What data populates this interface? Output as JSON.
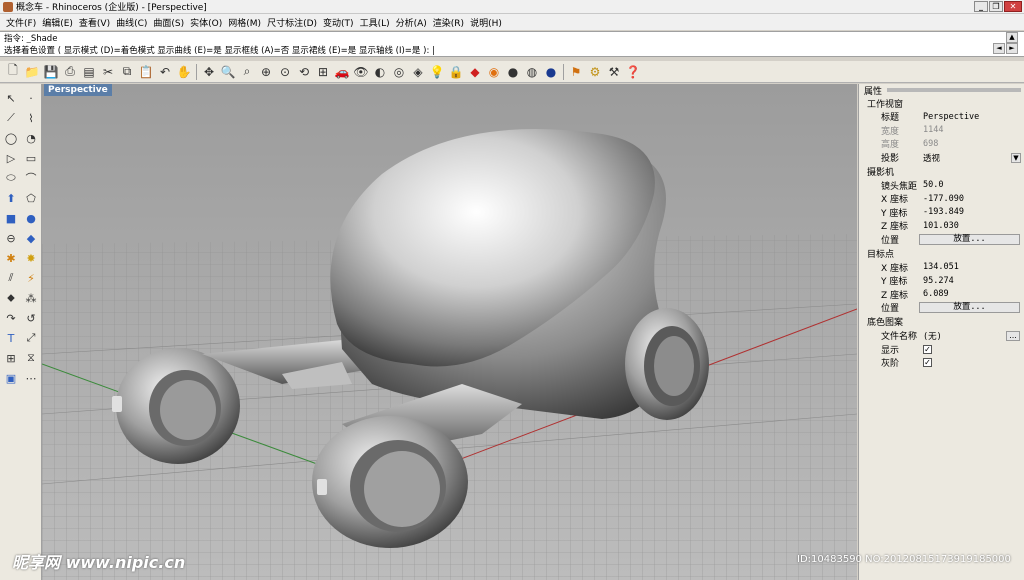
{
  "window": {
    "title": "概念车 - Rhinoceros (企业版) - [Perspective]"
  },
  "menu": [
    "文件(F)",
    "编辑(E)",
    "查看(V)",
    "曲线(C)",
    "曲面(S)",
    "实体(O)",
    "网格(M)",
    "尺寸标注(D)",
    "变动(T)",
    "工具(L)",
    "分析(A)",
    "渲染(R)",
    "说明(H)"
  ],
  "command": {
    "line1": "指令: _Shade",
    "line2": "选择着色设置 ( 显示模式 (D)=着色模式  显示曲线 (E)=是  显示框线 (A)=否  显示裙线 (E)=是  显示轴线 (I)=是 ): |"
  },
  "viewport": {
    "tab_label": "Perspective"
  },
  "properties": {
    "header": "属性",
    "section_viewport": "工作视窗",
    "title_label": "标题",
    "title_value": "Perspective",
    "width_label": "宽度",
    "width_value": "1144",
    "height_label": "高度",
    "height_value": "698",
    "projection_label": "投影",
    "projection_value": "透视",
    "section_camera": "摄影机",
    "lens_label": "镜头焦距",
    "lens_value": "50.0",
    "cam_x_label": "X 座标",
    "cam_x_value": "-177.090",
    "cam_y_label": "Y 座标",
    "cam_y_value": "-193.849",
    "cam_z_label": "Z 座标",
    "cam_z_value": "101.030",
    "cam_pos_label": "位置",
    "cam_pos_button": "放置...",
    "section_target": "目标点",
    "tgt_x_label": "X 座标",
    "tgt_x_value": "134.051",
    "tgt_y_label": "Y 座标",
    "tgt_y_value": "95.274",
    "tgt_z_label": "Z 座标",
    "tgt_z_value": "6.089",
    "tgt_pos_label": "位置",
    "tgt_pos_button": "放置...",
    "section_background": "底色图案",
    "file_label": "文件名称",
    "file_value": "(无)",
    "show_label": "显示",
    "gray_label": "灰阶"
  },
  "watermark": {
    "left": "昵享网 www.nipic.cn",
    "right": "ID:10483590 NO:20120815173919185000"
  }
}
